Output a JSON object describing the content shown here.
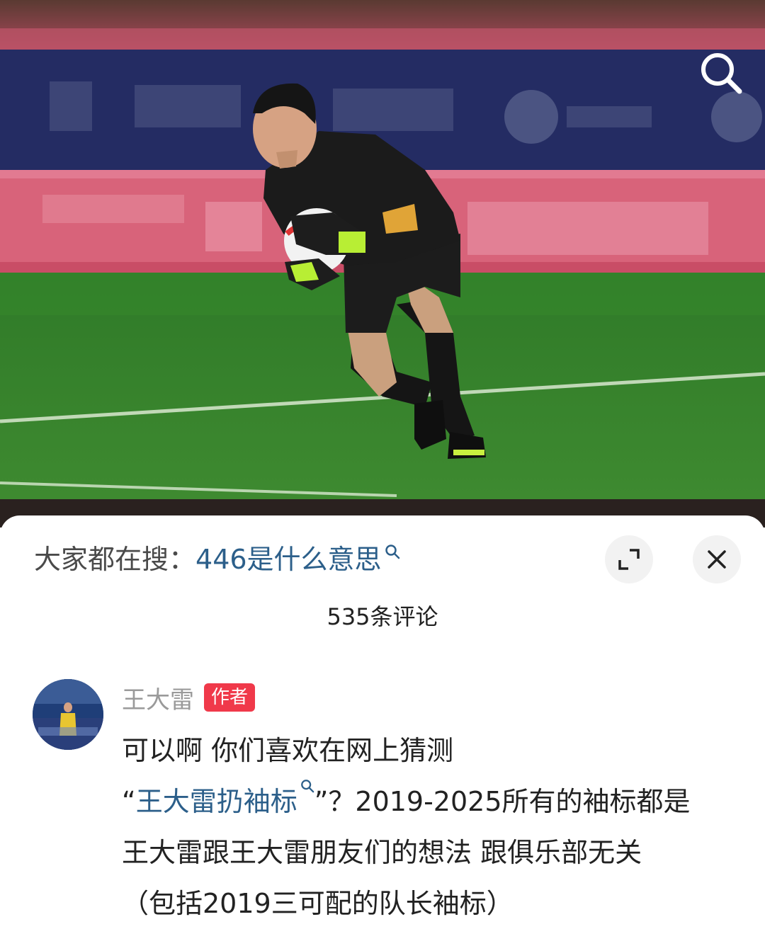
{
  "hot_search": {
    "prefix": "大家都在搜：",
    "query": "446是什么意思"
  },
  "comments": {
    "count_label": "535条评论"
  },
  "comment": {
    "author": "王大雷",
    "author_badge": "作者",
    "line1": "可以啊 你们喜欢在网上猜测",
    "quote_open": "“",
    "topic_link": "王大雷扔袖标",
    "line2_rest": "”？2019-2025所有的袖标都是",
    "line3": "王大雷跟王大雷朋友们的想法 跟俱乐部无关",
    "line4_partial": "（包括2019三可配的队长袖标）"
  },
  "icons": {
    "search": "search-icon",
    "expand": "expand-icon",
    "close": "close-icon",
    "query_search": "search-icon"
  },
  "colors": {
    "link": "#2c5f8a",
    "badge": "#f0394a",
    "pitch": "#3a7a2a"
  }
}
